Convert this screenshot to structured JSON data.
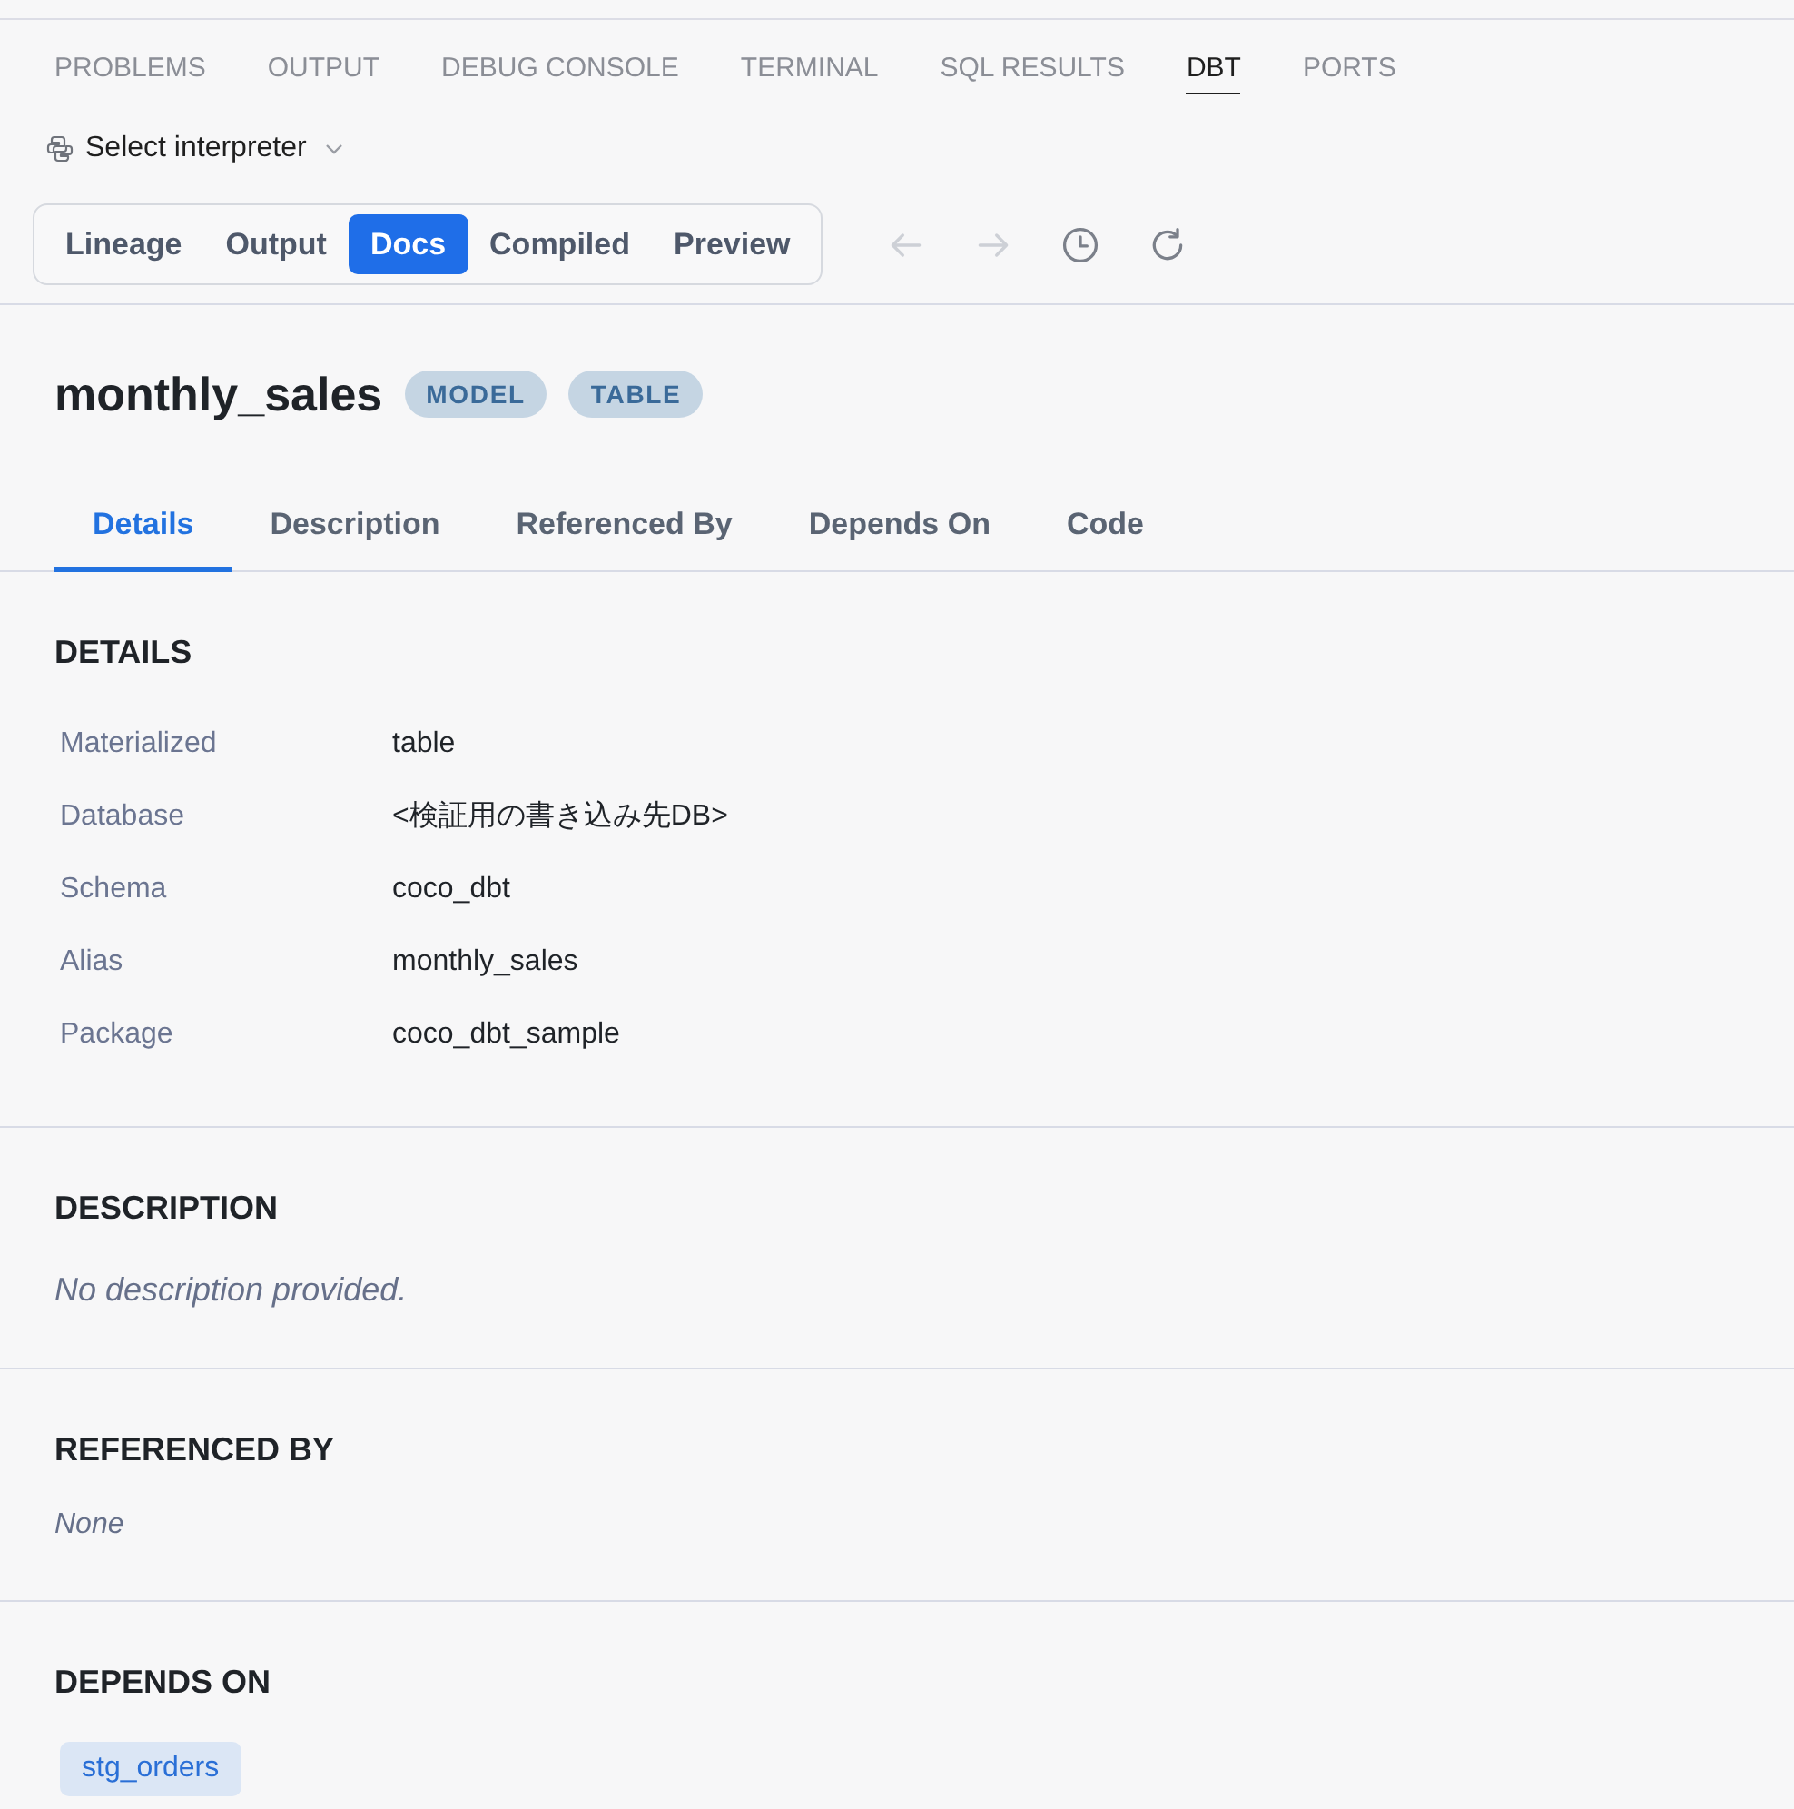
{
  "panel_tabs": [
    {
      "label": "PROBLEMS",
      "selected": false
    },
    {
      "label": "OUTPUT",
      "selected": false
    },
    {
      "label": "DEBUG CONSOLE",
      "selected": false
    },
    {
      "label": "TERMINAL",
      "selected": false
    },
    {
      "label": "SQL RESULTS",
      "selected": false
    },
    {
      "label": "DBT",
      "selected": true
    },
    {
      "label": "PORTS",
      "selected": false
    }
  ],
  "interpreter": {
    "label": "Select interpreter"
  },
  "view_switch": [
    {
      "label": "Lineage",
      "selected": false
    },
    {
      "label": "Output",
      "selected": false
    },
    {
      "label": "Docs",
      "selected": true
    },
    {
      "label": "Compiled",
      "selected": false
    },
    {
      "label": "Preview",
      "selected": false
    }
  ],
  "nav_buttons": [
    {
      "kind": "back",
      "disabled": true
    },
    {
      "kind": "forward",
      "disabled": true
    },
    {
      "kind": "history",
      "disabled": false
    },
    {
      "kind": "refresh",
      "disabled": false
    }
  ],
  "model": {
    "name": "monthly_sales",
    "badges": [
      "MODEL",
      "TABLE"
    ]
  },
  "doc_tabs": [
    {
      "label": "Details",
      "selected": true
    },
    {
      "label": "Description",
      "selected": false
    },
    {
      "label": "Referenced By",
      "selected": false
    },
    {
      "label": "Depends On",
      "selected": false
    },
    {
      "label": "Code",
      "selected": false
    }
  ],
  "sections": [
    {
      "kind": "properties",
      "heading": "DETAILS",
      "rows": [
        {
          "key": "Materialized",
          "value": "table"
        },
        {
          "key": "Database",
          "value": "<検証用の書き込み先DB>"
        },
        {
          "key": "Schema",
          "value": "coco_dbt"
        },
        {
          "key": "Alias",
          "value": "monthly_sales"
        },
        {
          "key": "Package",
          "value": "coco_dbt_sample"
        }
      ]
    },
    {
      "kind": "paragraph",
      "heading": "DESCRIPTION",
      "note": "No description provided."
    },
    {
      "kind": "refs",
      "heading": "REFERENCED BY",
      "note": "None"
    },
    {
      "kind": "refs",
      "heading": "DEPENDS ON",
      "chips": [
        "stg_orders"
      ]
    }
  ]
}
